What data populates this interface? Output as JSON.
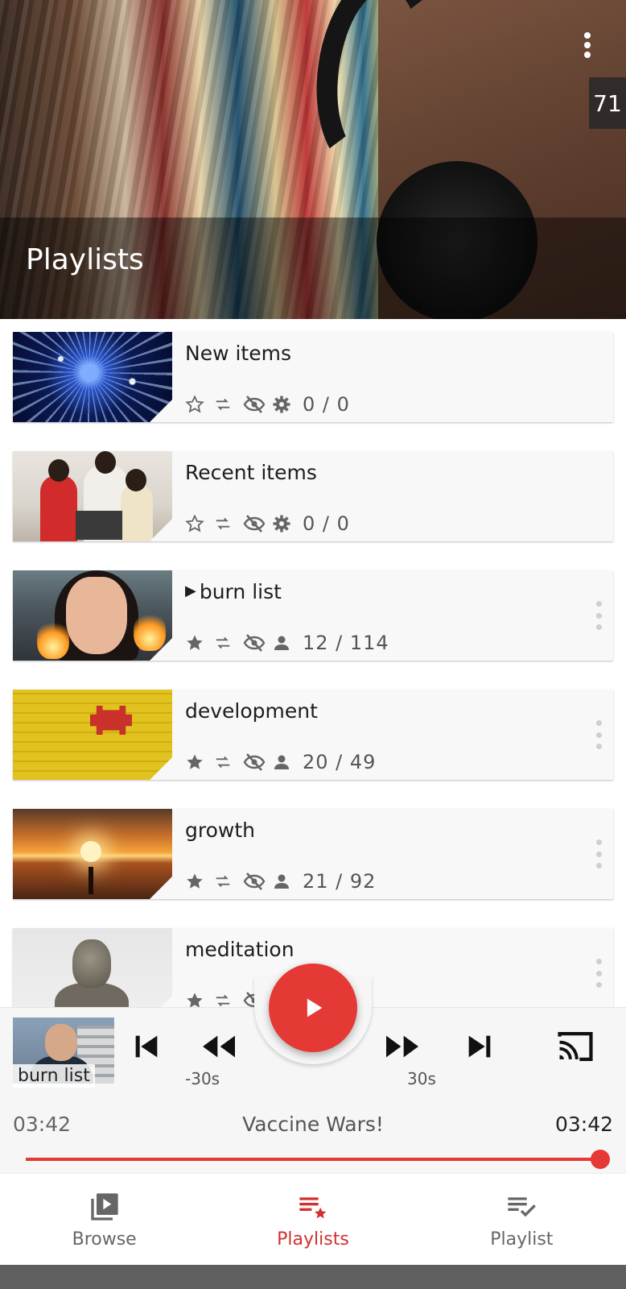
{
  "header": {
    "title": "Playlists",
    "count": "71"
  },
  "playlists": [
    {
      "title": "New items",
      "playing": false,
      "favorite": false,
      "owner_icon": "gear-icon",
      "count": "0 / 0"
    },
    {
      "title": "Recent items",
      "playing": false,
      "favorite": false,
      "owner_icon": "gear-icon",
      "count": "0 / 0"
    },
    {
      "title": "burn list",
      "playing": true,
      "favorite": true,
      "owner_icon": "person-icon",
      "count": "12 / 114"
    },
    {
      "title": "development",
      "playing": false,
      "favorite": true,
      "owner_icon": "person-icon",
      "count": "20 / 49"
    },
    {
      "title": "growth",
      "playing": false,
      "favorite": true,
      "owner_icon": "person-icon",
      "count": "21 / 92"
    },
    {
      "title": "meditation",
      "playing": false,
      "favorite": true,
      "owner_icon": "person-icon",
      "count": ""
    }
  ],
  "player": {
    "thumb_label": "burn list",
    "rewind_label": "-30s",
    "forward_label": "30s",
    "elapsed": "03:42",
    "title": "Vaccine Wars!",
    "duration": "03:42",
    "progress": 1.0
  },
  "nav": {
    "browse": "Browse",
    "playlists": "Playlists",
    "playlist": "Playlist",
    "active": "playlists"
  },
  "colors": {
    "accent": "#e53935",
    "active_nav": "#d32f2f"
  }
}
